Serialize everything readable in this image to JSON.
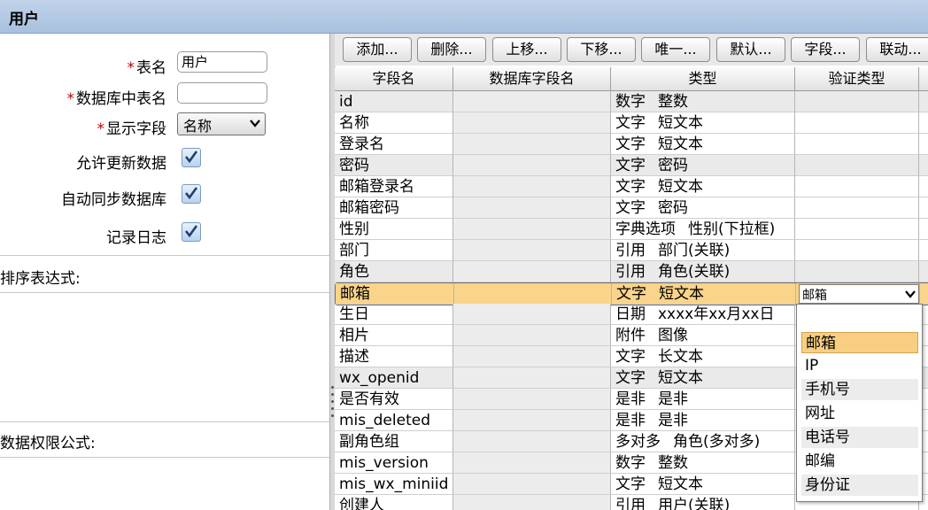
{
  "window": {
    "title": "用户"
  },
  "form": {
    "table_name_label": "表名",
    "table_name_value": "用户",
    "db_table_label": "数据库中表名",
    "db_table_value": "",
    "display_field_label": "显示字段",
    "display_field_value": "名称",
    "allow_update_label": "允许更新数据",
    "auto_sync_label": "自动同步数据库",
    "log_label": "记录日志",
    "sort_expr_label": "排序表达式:",
    "permission_label": "数据权限公式:",
    "required_mark": "*"
  },
  "toolbar": [
    "添加...",
    "删除...",
    "上移...",
    "下移...",
    "唯一...",
    "默认...",
    "字段...",
    "联动..."
  ],
  "grid": {
    "columns": [
      "字段名",
      "数据库字段名",
      "类型",
      "验证类型"
    ],
    "rows": [
      {
        "name": "id",
        "type": "数字",
        "sub": "整数"
      },
      {
        "name": "名称",
        "type": "文字",
        "sub": "短文本"
      },
      {
        "name": "登录名",
        "type": "文字",
        "sub": "短文本"
      },
      {
        "name": "密码",
        "type": "文字",
        "sub": "密码"
      },
      {
        "name": "邮箱登录名",
        "type": "文字",
        "sub": "短文本"
      },
      {
        "name": "邮箱密码",
        "type": "文字",
        "sub": "密码"
      },
      {
        "name": "性别",
        "type": "字典选项",
        "sub": "性别(下拉框)"
      },
      {
        "name": "部门",
        "type": "引用",
        "sub": "部门(关联)"
      },
      {
        "name": "角色",
        "type": "引用",
        "sub": "角色(关联)"
      },
      {
        "name": "邮箱",
        "type": "文字",
        "sub": "短文本"
      },
      {
        "name": "生日",
        "type": "日期",
        "sub": "xxxx年xx月xx日"
      },
      {
        "name": "相片",
        "type": "附件",
        "sub": "图像"
      },
      {
        "name": "描述",
        "type": "文字",
        "sub": "长文本"
      },
      {
        "name": "wx_openid",
        "type": "文字",
        "sub": "短文本"
      },
      {
        "name": "是否有效",
        "type": "是非",
        "sub": "是非"
      },
      {
        "name": "mis_deleted",
        "type": "是非",
        "sub": "是非"
      },
      {
        "name": "副角色组",
        "type": "多对多",
        "sub": "角色(多对多)"
      },
      {
        "name": "mis_version",
        "type": "数字",
        "sub": "整数"
      },
      {
        "name": "mis_wx_miniid",
        "type": "文字",
        "sub": "短文本"
      },
      {
        "name": "创建人",
        "type": "引用",
        "sub": "用户(关联)"
      }
    ],
    "selected_validation": "邮箱",
    "validation_options": [
      "",
      "邮箱",
      "IP",
      "手机号",
      "网址",
      "电话号",
      "邮编",
      "身份证"
    ]
  }
}
